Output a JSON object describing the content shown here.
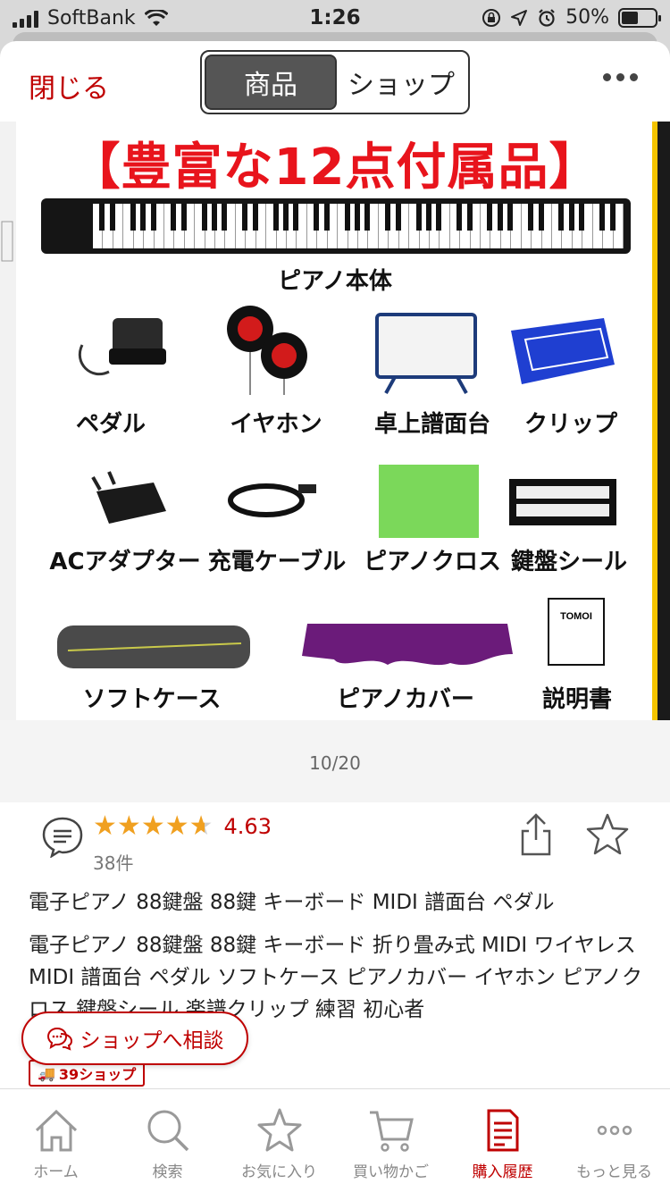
{
  "status_bar": {
    "carrier": "SoftBank",
    "time": "1:26",
    "battery": "50%"
  },
  "topbar": {
    "close_label": "閉じる",
    "segments": [
      {
        "label": "商品",
        "active": true
      },
      {
        "label": "ショップ",
        "active": false
      }
    ],
    "more_icon": "ellipsis-icon"
  },
  "gallery": {
    "promo_title": "【豊富な12点付属品】",
    "items": [
      "ピアノ本体",
      "ペダル",
      "イヤホン",
      "卓上譜面台",
      "クリップ",
      "ACアダプター",
      "充電ケーブル",
      "ピアノクロス",
      "鍵盤シール",
      "ソフトケース",
      "ピアノカバー",
      "説明書"
    ],
    "manual_brand": "TOMOI",
    "pager": "10/20"
  },
  "review": {
    "rating": 4.63,
    "rating_text": "4.63",
    "count": "38件",
    "rating_color": "#f0a020"
  },
  "product": {
    "title_short": "電子ピアノ 88鍵盤 88鍵 キーボード MIDI 譜面台 ペダル",
    "title_long": "電子ピアノ 88鍵盤 88鍵 キーボード 折り畳み式 MIDI ワイヤレスMIDI 譜面台 ペダル ソフトケース ピアノカバー イヤホン ピアノクロス 鍵盤シール 楽譜クリップ 練習 初心者"
  },
  "consult": {
    "label": "ショップへ相談"
  },
  "shipping_badge": "39ショップ",
  "tabbar": [
    {
      "label": "ホーム",
      "icon": "home-icon",
      "active": false
    },
    {
      "label": "検索",
      "icon": "search-icon",
      "active": false
    },
    {
      "label": "お気に入り",
      "icon": "star-icon",
      "active": false
    },
    {
      "label": "買い物かご",
      "icon": "cart-icon",
      "active": false
    },
    {
      "label": "購入履歴",
      "icon": "receipt-icon",
      "active": true
    },
    {
      "label": "もっと見る",
      "icon": "more-icon",
      "active": false
    }
  ],
  "colors": {
    "accent": "#bf0000",
    "promo_red": "#e8141c",
    "star": "#f0a020"
  }
}
